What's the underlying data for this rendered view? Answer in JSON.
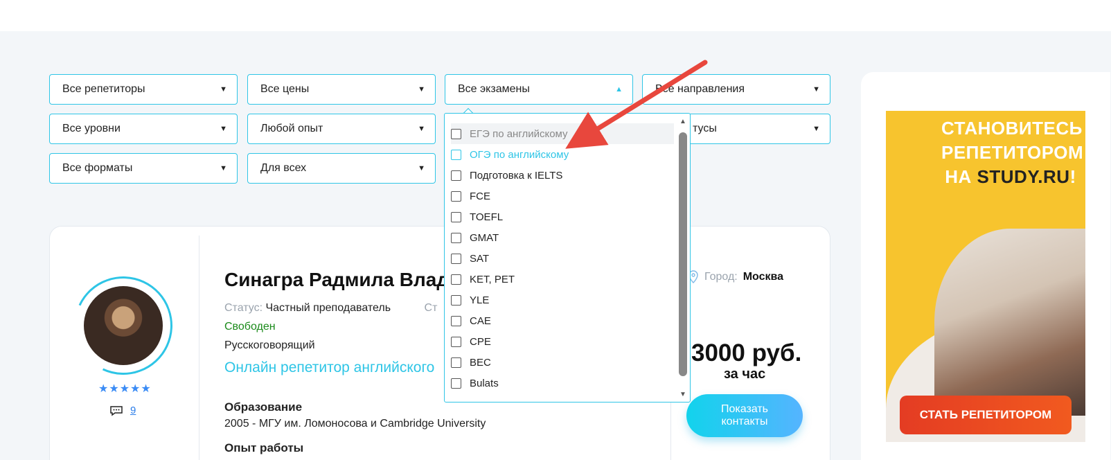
{
  "filters": {
    "row1": [
      "Все репетиторы",
      "Все цены",
      "Все экзамены",
      "Все направления"
    ],
    "row2": [
      "Все уровни",
      "Любой опыт",
      "",
      "тусы"
    ],
    "row3": [
      "Все форматы",
      "Для всех"
    ]
  },
  "exam_dropdown": {
    "options": [
      "ЕГЭ по английскому",
      "ОГЭ по английскому",
      "Подготовка к IELTS",
      "FCE",
      "TOEFL",
      "GMAT",
      "SAT",
      "KET, PET",
      "YLE",
      "CAE",
      "CPE",
      "BEC",
      "Bulats"
    ],
    "hovered_index": 0,
    "active_index": 1
  },
  "tutor": {
    "name": "Синагра Радмила Влад",
    "status_label": "Статус:",
    "status_value": "Частный преподаватель",
    "status_cut": "Ст",
    "availability": "Свободен",
    "language": "Русскоговорящий",
    "subject": "Онлайн репетитор английского",
    "rating_stars": 5,
    "stars_text": "★★★★★",
    "reviews_count": "9",
    "education_heading": "Образование",
    "education_text": "2005 - МГУ им. Ломоносова и Cambridge University",
    "experience_heading": "Опыт работы",
    "city_label": "Город:",
    "city_value": "Москва",
    "price": "3000 руб.",
    "price_unit": "за час",
    "contacts_button_line1": "Показать",
    "contacts_button_line2": "контакты"
  },
  "banner": {
    "line1": "СТАНОВИТЕСЬ",
    "line2": "РЕПЕТИТОРОМ",
    "line3_prefix": "НА ",
    "line3_brand": "STUDY.RU",
    "line3_suffix": "!",
    "cta": "СТАТЬ РЕПЕТИТОРОМ"
  },
  "colors": {
    "accent": "#2ec5e6",
    "arrow": "#e8473d",
    "banner_bg": "#f7c42e",
    "banner_cta": "#e43c23",
    "free_status": "#1a8a1a",
    "stars": "#3a8bf5"
  }
}
